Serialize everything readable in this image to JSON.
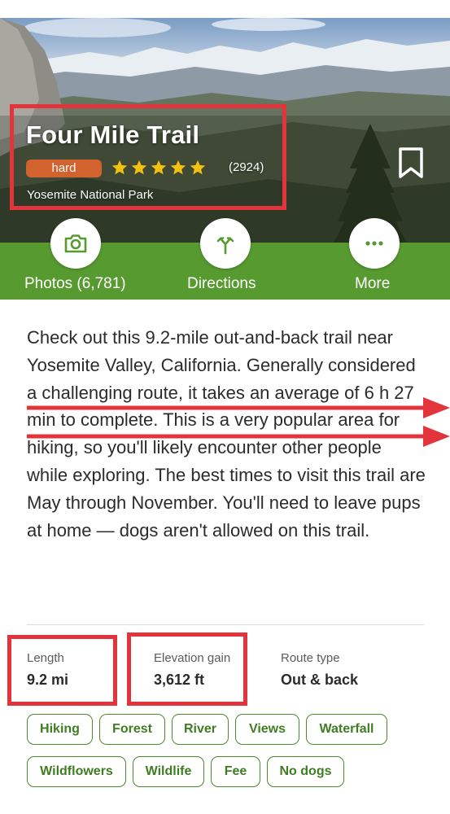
{
  "trail": {
    "title": "Four Mile Trail",
    "difficulty": "hard",
    "rating": 5,
    "review_count": "(2924)",
    "park": "Yosemite National Park"
  },
  "actions": [
    {
      "label": "Photos (6,781)",
      "icon": "camera-icon"
    },
    {
      "label": "Directions",
      "icon": "directions-icon"
    },
    {
      "label": "More",
      "icon": "more-icon"
    }
  ],
  "description": "Check out this 9.2-mile out-and-back trail near Yosemite Valley, California. Generally considered a challenging route, it takes an average of 6 h 27 min to complete. This is a very popular area for hiking, so you'll likely encounter other people while exploring. The best times to visit this trail are May through November. You'll need to leave pups at home — dogs aren't allowed on this trail.",
  "stats": {
    "length": {
      "label": "Length",
      "value": "9.2 mi"
    },
    "elevation": {
      "label": "Elevation gain",
      "value": "3,612 ft"
    },
    "route": {
      "label": "Route type",
      "value": "Out & back"
    }
  },
  "tags": [
    "Hiking",
    "Forest",
    "River",
    "Views",
    "Waterfall",
    "Wildflowers",
    "Wildlife",
    "Fee",
    "No dogs"
  ],
  "colors": {
    "brand_green": "#579a30",
    "annotation_red": "#e3343b",
    "difficulty_hard": "#d2632e",
    "star": "#f2c10f"
  }
}
